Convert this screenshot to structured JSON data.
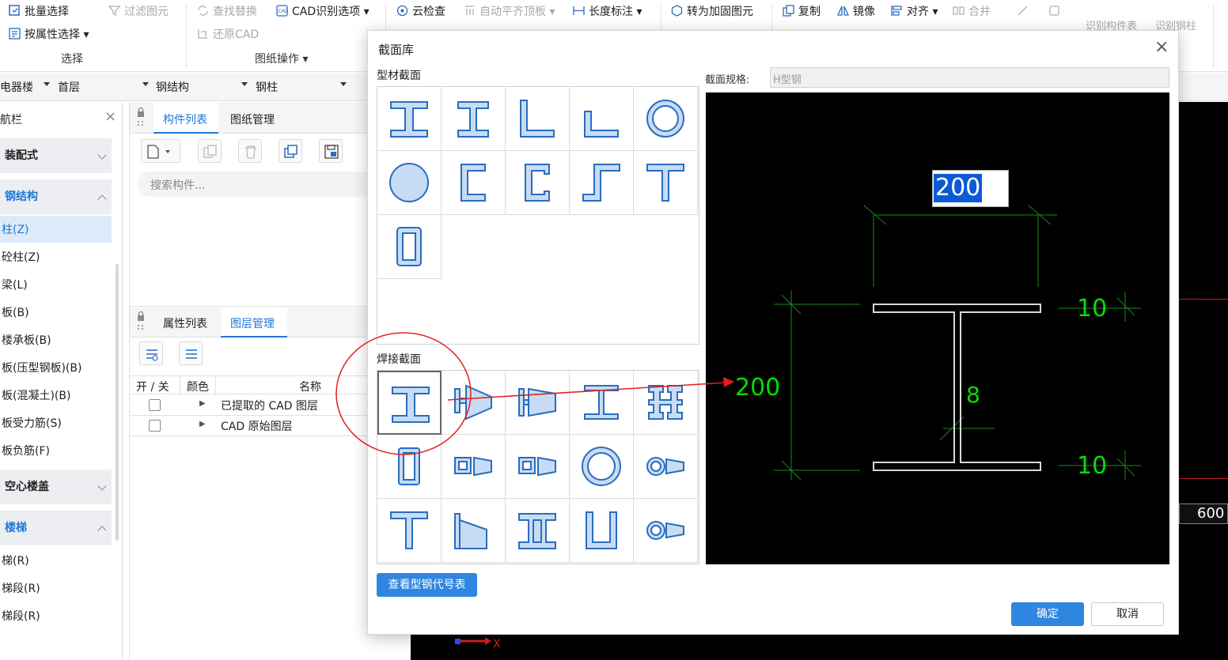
{
  "ribbon": {
    "batch_select": "批量选择",
    "filter_elements": "过滤图元",
    "find_replace": "查找替换",
    "cad_options": "CAD识别选项",
    "cloud_check": "云检查",
    "auto_align": "自动平齐顶板",
    "length_mark": "长度标注",
    "convert": "转为加固图元",
    "copy": "复制",
    "mirror": "镜像",
    "align": "对齐",
    "merge": "合并",
    "recognize_table": "识别构件表",
    "recognize_steel": "识别钢柱",
    "attr_select": "按属性选择",
    "restore_cad": "还原CAD",
    "group_select": "选择",
    "group_drawing": "图纸操作"
  },
  "filterbar": {
    "building": "电器楼",
    "floor": "首层",
    "category": "钢结构",
    "type": "钢柱"
  },
  "leftnav": {
    "title": "航栏",
    "items": [
      {
        "label": "装配式",
        "kind": "head",
        "open": false
      },
      {
        "label": "钢结构",
        "kind": "head",
        "open": true
      },
      {
        "label": "柱(Z)",
        "kind": "item",
        "selected": true
      },
      {
        "label": "砼柱(Z)",
        "kind": "item"
      },
      {
        "label": "梁(L)",
        "kind": "item"
      },
      {
        "label": "板(B)",
        "kind": "item"
      },
      {
        "label": "楼承板(B)",
        "kind": "item"
      },
      {
        "label": "板(压型钢板)(B)",
        "kind": "item"
      },
      {
        "label": "板(混凝土)(B)",
        "kind": "item"
      },
      {
        "label": "板受力筋(S)",
        "kind": "item"
      },
      {
        "label": "板负筋(F)",
        "kind": "item"
      },
      {
        "label": "空心楼盖",
        "kind": "head",
        "open": false
      },
      {
        "label": "楼梯",
        "kind": "head",
        "open": true
      },
      {
        "label": "梯(R)",
        "kind": "item"
      },
      {
        "label": "梯段(R)",
        "kind": "item"
      },
      {
        "label": "梯段(R)",
        "kind": "item"
      }
    ]
  },
  "component_panel": {
    "tab_list": "构件列表",
    "tab_drawing": "图纸管理",
    "search_placeholder": "搜索构件..."
  },
  "layer_panel": {
    "tab_attr": "属性列表",
    "tab_layer": "图层管理",
    "col_onoff": "开 / 关",
    "col_color": "颜色",
    "col_name": "名称",
    "rows": [
      {
        "name": "已提取的 CAD 图层"
      },
      {
        "name": "CAD 原始图层"
      }
    ]
  },
  "canvas": {
    "dimension_label": "600"
  },
  "dialog": {
    "title": "截面库",
    "section_profile": "型材截面",
    "section_welded": "焊接截面",
    "spec_label": "截面规格:",
    "spec_value": "H型钢",
    "btn_code_table": "查看型钢代号表",
    "btn_ok": "确定",
    "btn_cancel": "取消",
    "preview": {
      "width_value": "200",
      "height_value": "200",
      "flange_top": "10",
      "flange_bottom": "10",
      "web": "8"
    }
  },
  "colors": {
    "accent": "#1e78d7",
    "button": "#2f86e0",
    "dim_green": "#00e000",
    "annotation_red": "#e02020"
  }
}
